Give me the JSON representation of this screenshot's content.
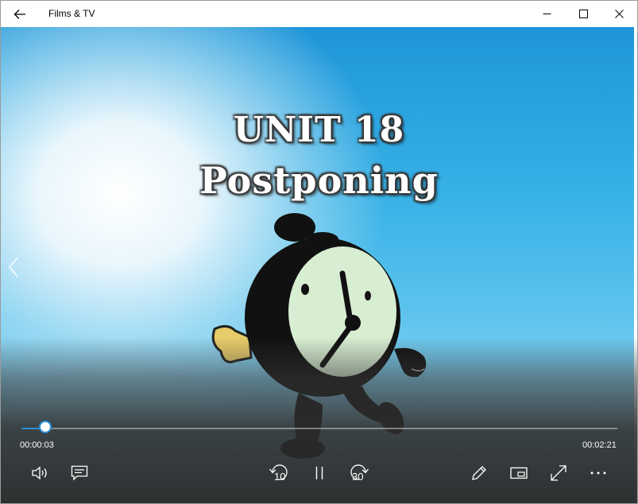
{
  "titlebar": {
    "title": "Films & TV",
    "back_icon": "back-arrow-icon",
    "minimize_icon": "minimize-icon",
    "maximize_icon": "maximize-icon",
    "close_icon": "close-icon"
  },
  "video": {
    "caption_line1": "UNIT 18",
    "caption_line2": "Postponing"
  },
  "player": {
    "current_time": "00:00:03",
    "duration": "00:02:21",
    "progress_fraction": 0.04,
    "skip_back_label": "10",
    "skip_forward_label": "30",
    "accent_color": "#2a8fd6"
  }
}
